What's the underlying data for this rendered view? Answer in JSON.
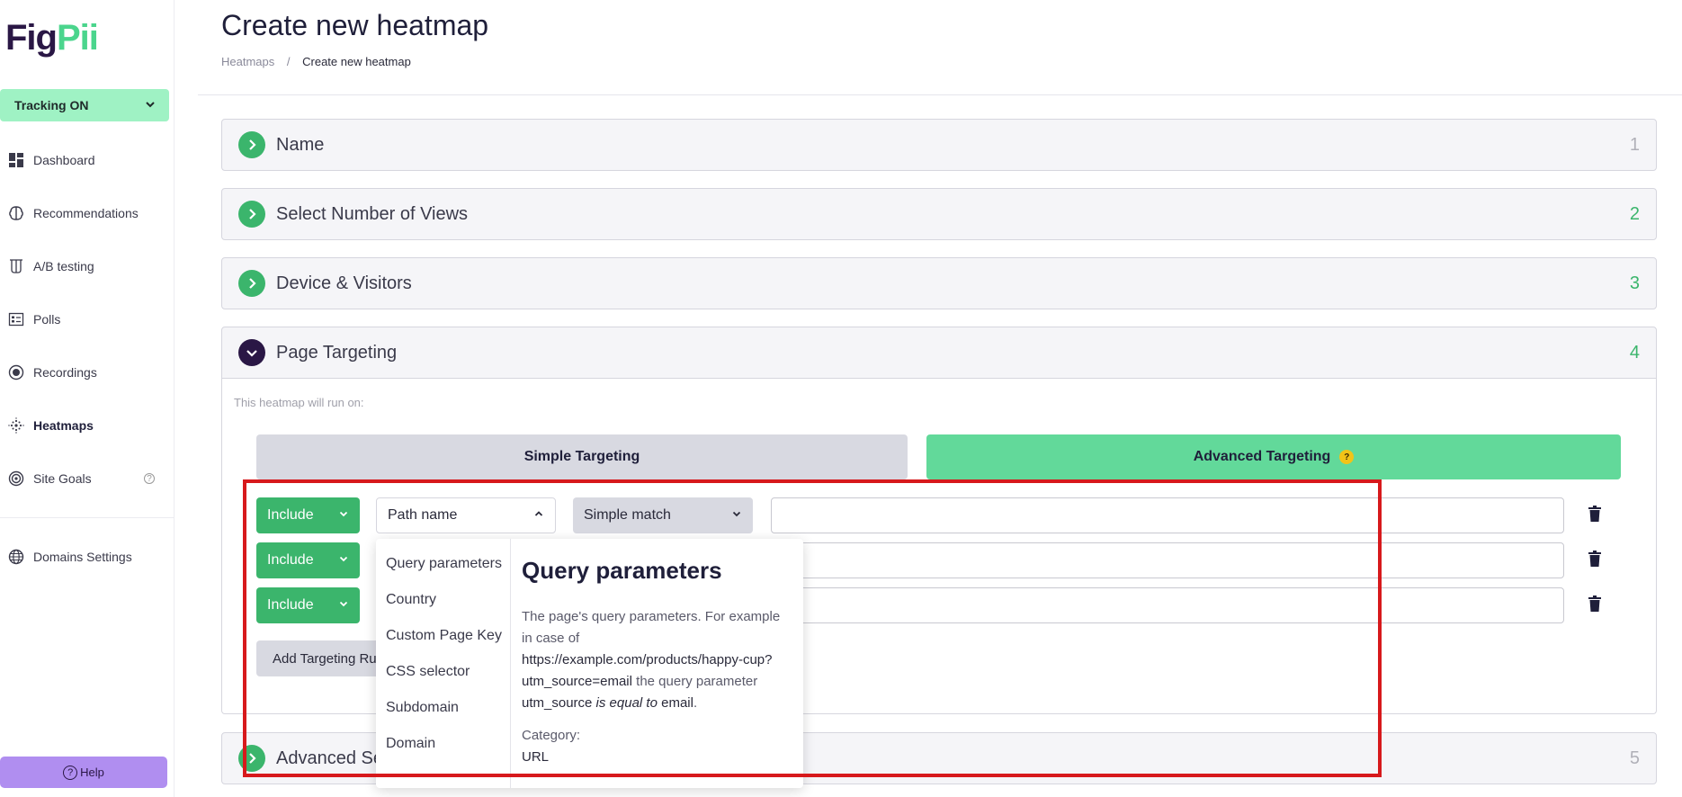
{
  "app": {
    "logo_part1": "Fig",
    "logo_part2": "Pii"
  },
  "tracking": {
    "label": "Tracking ON"
  },
  "sidebar": {
    "items": [
      {
        "label": "Dashboard",
        "icon": "dashboard-icon"
      },
      {
        "label": "Recommendations",
        "icon": "brain-icon"
      },
      {
        "label": "A/B testing",
        "icon": "flask-icon"
      },
      {
        "label": "Polls",
        "icon": "poll-icon"
      },
      {
        "label": "Recordings",
        "icon": "record-icon"
      },
      {
        "label": "Heatmaps",
        "icon": "heatmap-icon"
      },
      {
        "label": "Site Goals",
        "icon": "target-icon",
        "hint": "?"
      },
      {
        "label": "Domains Settings",
        "icon": "globe-icon"
      }
    ],
    "help_label": "Help"
  },
  "header": {
    "title": "Create new heatmap",
    "breadcrumb": {
      "parent": "Heatmaps",
      "separator": "/",
      "current": "Create new heatmap"
    }
  },
  "steps": [
    {
      "label": "Name",
      "number": "1"
    },
    {
      "label": "Select Number of Views",
      "number": "2"
    },
    {
      "label": "Device & Visitors",
      "number": "3"
    },
    {
      "label": "Page Targeting",
      "number": "4"
    },
    {
      "label": "Advanced Se",
      "number": "5"
    }
  ],
  "targeting": {
    "intro": "This heatmap will run on:",
    "tab_simple": "Simple Targeting",
    "tab_advanced": "Advanced Targeting",
    "tab_advanced_hint": "?",
    "rules": [
      {
        "mode": "Include",
        "field": "Path name",
        "match": "Simple match",
        "value": ""
      },
      {
        "mode": "Include",
        "value": ""
      },
      {
        "mode": "Include",
        "value": ""
      }
    ],
    "add_rule_label": "Add Targeting Ru"
  },
  "dropdown": {
    "options": [
      "Query parameters",
      "Country",
      "Custom Page Key",
      "CSS selector",
      "Subdomain",
      "Domain"
    ],
    "detail": {
      "title": "Query parameters",
      "desc_1": "The page's query parameters. For example in case of ",
      "desc_url": "https://example.com/products/happy-cup?utm_source=email",
      "desc_2": " the query parameter ",
      "desc_param": "utm_source",
      "desc_3": " ",
      "desc_is_equal": "is equal to",
      "desc_4": " ",
      "desc_value": "email",
      "desc_5": ".",
      "category_label": "Category:",
      "category_value": "URL"
    }
  },
  "colors": {
    "accent_green": "#3bb56c",
    "brand_purple": "#2a1745",
    "highlight_red": "#d7191c"
  }
}
